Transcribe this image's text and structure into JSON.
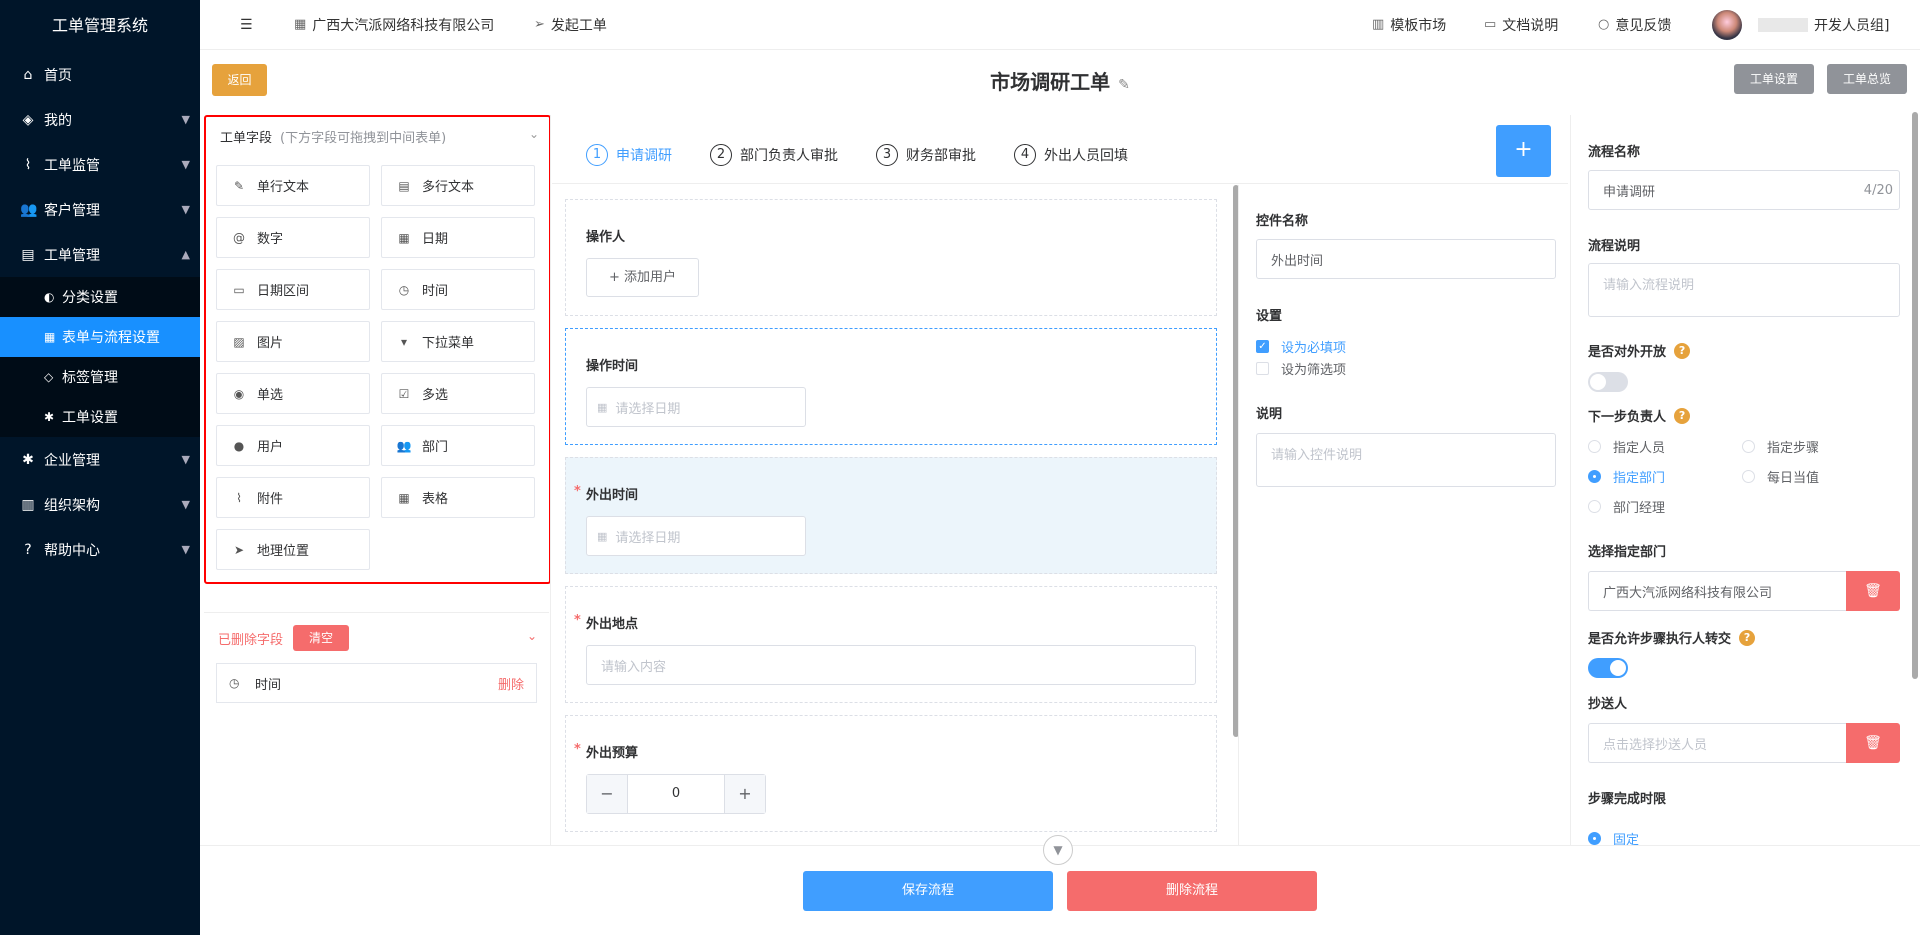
{
  "sidebar": {
    "title": "工单管理系统",
    "items": [
      {
        "icon": "home-icon",
        "glyph": "⌂",
        "label": "首页"
      },
      {
        "icon": "layers-icon",
        "glyph": "◈",
        "label": "我的"
      },
      {
        "icon": "pulse-icon",
        "glyph": "⌇",
        "label": "工单监管"
      },
      {
        "icon": "users-icon",
        "glyph": "👥",
        "label": "客户管理"
      },
      {
        "icon": "document-icon",
        "glyph": "▤",
        "label": "工单管理"
      }
    ],
    "subitems": [
      {
        "icon": "category-icon",
        "glyph": "◐",
        "label": "分类设置"
      },
      {
        "icon": "table-icon",
        "glyph": "▦",
        "label": "表单与流程设置"
      },
      {
        "icon": "tag-icon",
        "glyph": "◇",
        "label": "标签管理"
      },
      {
        "icon": "gear-icon",
        "glyph": "✱",
        "label": "工单设置"
      }
    ],
    "items2": [
      {
        "icon": "gear-icon",
        "glyph": "✱",
        "label": "企业管理"
      },
      {
        "icon": "org-icon",
        "glyph": "▥",
        "label": "组织架构"
      },
      {
        "icon": "help-icon",
        "glyph": "?",
        "label": "帮助中心"
      }
    ]
  },
  "topbar": {
    "company": "广西大汽派网络科技有限公司",
    "launch": "发起工单",
    "template_market": "模板市场",
    "docs": "文档说明",
    "feedback": "意见反馈",
    "user": "开发人员组]"
  },
  "header": {
    "back": "返回",
    "title": "市场调研工单",
    "settings": "工单设置",
    "overview": "工单总览"
  },
  "fields_panel": {
    "title": "工单字段",
    "hint": "(下方字段可拖拽到中间表单)",
    "fields": [
      {
        "icon": "edit-icon",
        "glyph": "✎",
        "label": "单行文本"
      },
      {
        "icon": "file-text-icon",
        "glyph": "▤",
        "label": "多行文本"
      },
      {
        "icon": "at-icon",
        "glyph": "@",
        "label": "数字"
      },
      {
        "icon": "calendar-icon",
        "glyph": "▦",
        "label": "日期"
      },
      {
        "icon": "date-range-icon",
        "glyph": "▭",
        "label": "日期区间"
      },
      {
        "icon": "clock-icon",
        "glyph": "◷",
        "label": "时间"
      },
      {
        "icon": "image-icon",
        "glyph": "▨",
        "label": "图片"
      },
      {
        "icon": "dropdown-icon",
        "glyph": "▾",
        "label": "下拉菜单"
      },
      {
        "icon": "radio-icon",
        "glyph": "◉",
        "label": "单选"
      },
      {
        "icon": "checkbox-icon",
        "glyph": "☑",
        "label": "多选"
      },
      {
        "icon": "user-icon",
        "glyph": "●",
        "label": "用户"
      },
      {
        "icon": "group-icon",
        "glyph": "👥",
        "label": "部门"
      },
      {
        "icon": "paperclip-icon",
        "glyph": "⌇",
        "label": "附件"
      },
      {
        "icon": "grid-icon",
        "glyph": "▦",
        "label": "表格"
      },
      {
        "icon": "location-icon",
        "glyph": "➤",
        "label": "地理位置"
      }
    ]
  },
  "deleted_panel": {
    "title": "已删除字段",
    "clear": "清空",
    "items": [
      {
        "label": "时间",
        "action": "删除"
      }
    ]
  },
  "steps": [
    {
      "num": "1",
      "label": "申请调研"
    },
    {
      "num": "2",
      "label": "部门负责人审批"
    },
    {
      "num": "3",
      "label": "财务部审批"
    },
    {
      "num": "4",
      "label": "外出人员回填"
    }
  ],
  "add_step": "+",
  "form": {
    "operator_label": "操作人",
    "add_user": "+ 添加用户",
    "op_time_label": "操作时间",
    "date_placeholder": "请选择日期",
    "out_time_label": "外出时间",
    "out_place_label": "外出地点",
    "text_placeholder": "请输入内容",
    "budget_label": "外出预算",
    "budget_value": "0",
    "required_mark": "*"
  },
  "props": {
    "name_label": "控件名称",
    "name_value": "外出时间",
    "settings_label": "设置",
    "required": "设为必填项",
    "filter": "设为筛选项",
    "desc_label": "说明",
    "desc_placeholder": "请输入控件说明"
  },
  "flow": {
    "name_label": "流程名称",
    "name_value": "申请调研",
    "name_count": "4/20",
    "desc_label": "流程说明",
    "desc_placeholder": "请输入流程说明",
    "public_label": "是否对外开放",
    "next_label": "下一步负责人",
    "options": [
      "指定人员",
      "指定步骤",
      "指定部门",
      "每日当值",
      "部门经理"
    ],
    "dept_label": "选择指定部门",
    "dept_value": "广西大汽派网络科技有限公司",
    "transfer_label": "是否允许步骤执行人转交",
    "cc_label": "抄送人",
    "cc_placeholder": "点击选择抄送人员",
    "deadline_label": "步骤完成时限",
    "deadline_option": "固定"
  },
  "footer": {
    "save": "保存流程",
    "delete": "删除流程"
  }
}
